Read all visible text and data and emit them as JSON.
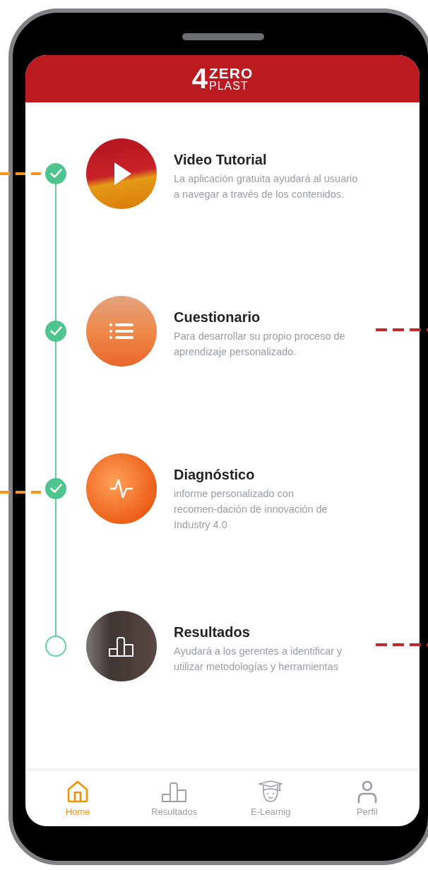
{
  "header": {
    "logo": {
      "mark": "4",
      "word_top": "ZERO",
      "word_bottom": "PLAST"
    }
  },
  "steps": [
    {
      "title": "Video Tutorial",
      "description_lines": [
        "La aplicación gratuita ayudará al usuario",
        "a navegar a través de los contenidos."
      ],
      "checked": true,
      "kind": "video",
      "callout_left": true
    },
    {
      "title": "Cuestionario",
      "description_lines": [
        "Para desarrollar su propio proceso de",
        "aprendizaje personalizado."
      ],
      "checked": true,
      "kind": "list",
      "callout_left": false
    },
    {
      "title": "Diagnóstico",
      "description_lines": [
        "informe personalizado con",
        "recomen-dación de innovación de",
        "Industry 4.0"
      ],
      "checked": true,
      "kind": "pulse",
      "callout_left": true
    },
    {
      "title": "Resultados",
      "description_lines": [
        "Ayudará a los gerentes a identificar y",
        "utilizar metodologías y herramientas"
      ],
      "checked": false,
      "kind": "bars",
      "callout_left": false
    }
  ],
  "nav": [
    {
      "label": "Home",
      "kind": "home",
      "selected": true
    },
    {
      "label": "Resultados",
      "kind": "bars",
      "selected": false
    },
    {
      "label": "E-Learnig",
      "kind": "graduate",
      "selected": false
    },
    {
      "label": "Perfil",
      "kind": "person",
      "selected": false
    }
  ]
}
